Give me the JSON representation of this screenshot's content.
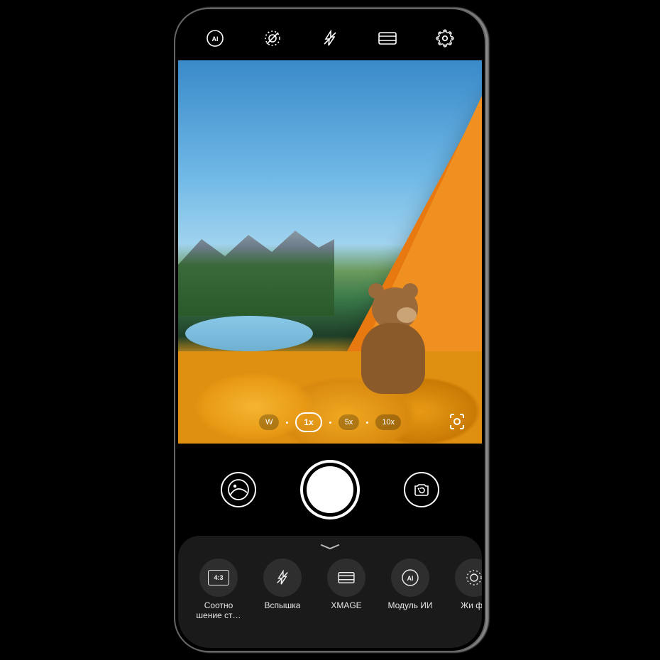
{
  "zoom": {
    "options": [
      "W",
      "1x",
      "5x",
      "10x"
    ],
    "active_index": 1
  },
  "bottom_panel": {
    "items": [
      {
        "label": "Соотно шение ст…",
        "icon": "aspect-ratio",
        "badge": "4:3"
      },
      {
        "label": "Вспышка",
        "icon": "flash-off"
      },
      {
        "label": "XMAGE",
        "icon": "xmage"
      },
      {
        "label": "Модуль ИИ",
        "icon": "ai"
      },
      {
        "label": "Жи фо",
        "icon": "live-photo"
      }
    ]
  },
  "icons": {
    "ai": "AI",
    "aspect_badge": "4:3"
  }
}
